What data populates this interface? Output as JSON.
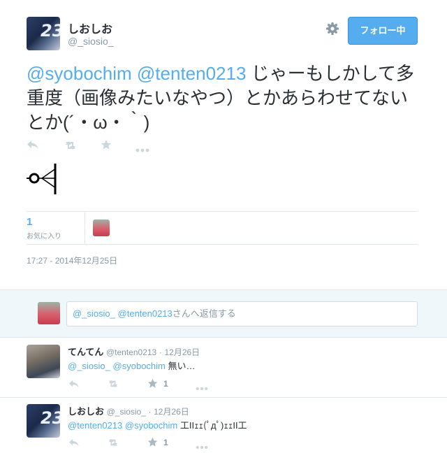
{
  "main_tweet": {
    "display_name": "しおしお",
    "handle": "@_siosio_",
    "follow_label": "フォロー中",
    "mention_1": "@syobochim",
    "mention_2": "@tenten0213",
    "text": " じゃーもしかして多重度（画像みたいなやつ）とかあらわせてないとか(´・ω・｀)",
    "favorites_count": "1",
    "favorites_label": "お気に入り",
    "timestamp": "17:27 - 2014年12月25日"
  },
  "reply_box": {
    "placeholder_mention_1": "@_siosio_",
    "placeholder_mention_2": "@tenten0213",
    "placeholder_suffix": "さんへ返信する"
  },
  "replies": [
    {
      "display_name": "てんてん",
      "handle": "@tenten0213",
      "date": "12月26日",
      "mention_1": "@_siosio_",
      "mention_2": "@syobochim",
      "text": " 無い…",
      "fav_count": "1"
    },
    {
      "display_name": "しおしお",
      "handle": "@_siosio_",
      "date": "12月26日",
      "mention_1": "@tenten0213",
      "mention_2": "@syobochim",
      "text": " 工IIｪｪ(ﾟдﾟ)ｪｪII工",
      "fav_count": "1"
    }
  ],
  "separator": "·",
  "icons": {
    "reply": "reply-icon",
    "retweet": "retweet-icon",
    "favorite": "star-icon",
    "more": "more-icon",
    "settings": "gear-icon"
  },
  "colors": {
    "accent": "#55acee",
    "handle": "#8899a6",
    "text": "#292f33",
    "action_icon": "#ccd6dd",
    "reply_bg": "#eff7fa"
  }
}
